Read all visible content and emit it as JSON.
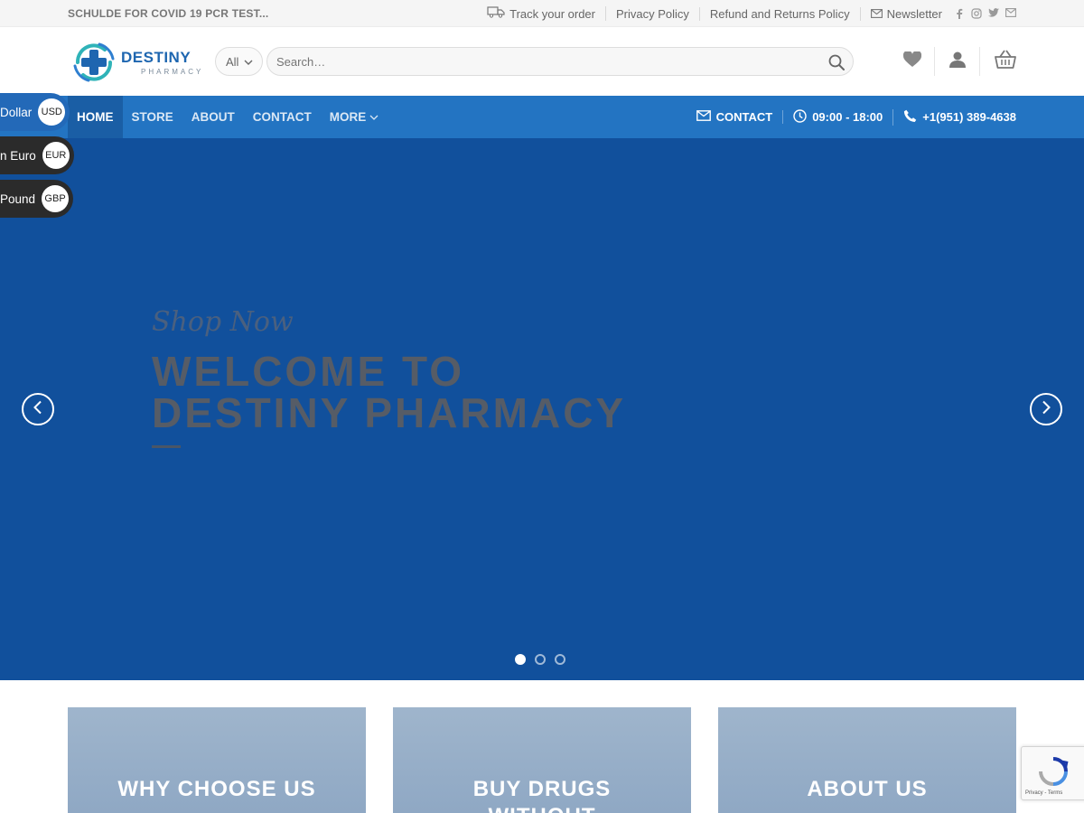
{
  "topbar": {
    "announcement": "SCHULDE FOR COVID 19 PCR TEST...",
    "links": [
      {
        "label": "Track your order",
        "icon": "truck-icon"
      },
      {
        "label": "Privacy Policy"
      },
      {
        "label": "Refund and Returns Policy"
      },
      {
        "label": "Newsletter",
        "icon": "envelope-icon"
      }
    ],
    "social_icons": [
      "facebook-icon",
      "instagram-icon",
      "twitter-icon",
      "email-icon"
    ]
  },
  "header": {
    "logo": {
      "brand": "DESTINY",
      "sub": "PHARMACY"
    },
    "category_select": "All",
    "search_placeholder": "Search…",
    "icons": [
      "heart-icon",
      "user-icon",
      "basket-icon"
    ]
  },
  "nav": {
    "items": [
      {
        "label": "HOME",
        "active": true
      },
      {
        "label": "STORE"
      },
      {
        "label": "ABOUT"
      },
      {
        "label": "CONTACT"
      },
      {
        "label": "MORE"
      }
    ],
    "right": {
      "contact": "CONTACT",
      "hours": "09:00 - 18:00",
      "phone": "+1(951) 389-4638"
    }
  },
  "currency": [
    {
      "name": "Dollar",
      "code": "USD",
      "selected": true
    },
    {
      "name": "n Euro",
      "code": "EUR",
      "selected": false
    },
    {
      "name": "Pound",
      "code": "GBP",
      "selected": false
    }
  ],
  "hero": {
    "tagline": "Shop Now",
    "title_line1": "WELCOME TO",
    "title_line2": "DESTINY PHARMACY",
    "slide_count": 3,
    "active_slide": 1,
    "colors": {
      "background": "#11509c",
      "nav": "#2374c2"
    }
  },
  "cards": [
    {
      "title": "WHY CHOOSE US"
    },
    {
      "title": "BUY DRUGS",
      "title2": "WITHOUT"
    },
    {
      "title": "ABOUT US"
    }
  ],
  "recaptcha": {
    "text": "Privacy - Terms"
  }
}
